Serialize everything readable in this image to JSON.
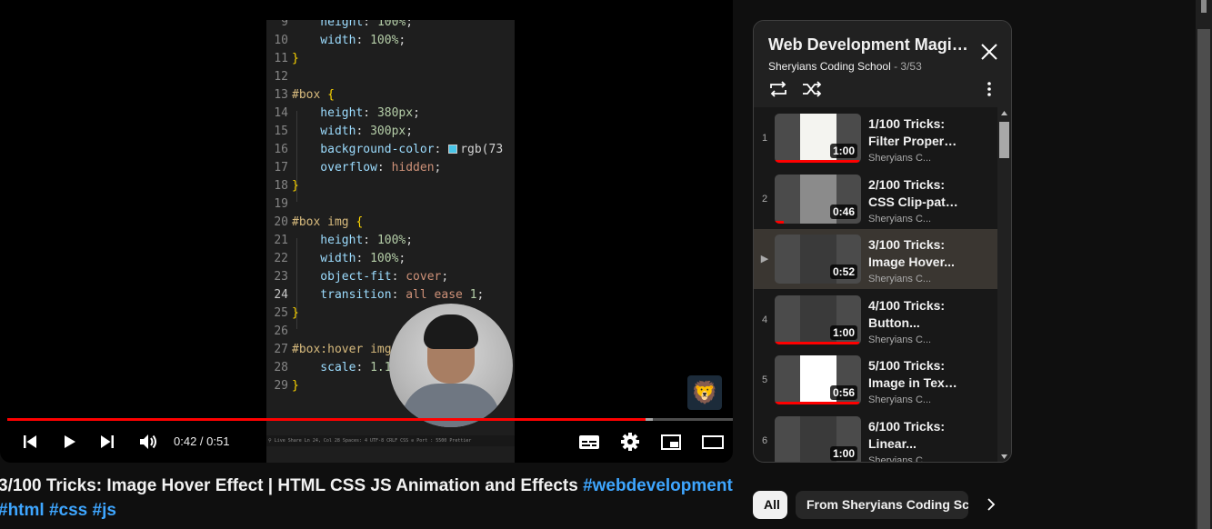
{
  "editor": {
    "lines": [
      {
        "num": "9",
        "text": [
          {
            "c": "tk-prop",
            "t": "    height"
          },
          {
            "c": "tk-plain",
            "t": ": "
          },
          {
            "c": "tk-val",
            "t": "100%"
          },
          {
            "c": "tk-plain",
            "t": ";"
          }
        ]
      },
      {
        "num": "10",
        "text": [
          {
            "c": "tk-prop",
            "t": "    width"
          },
          {
            "c": "tk-plain",
            "t": ": "
          },
          {
            "c": "tk-val",
            "t": "100%"
          },
          {
            "c": "tk-plain",
            "t": ";"
          }
        ]
      },
      {
        "num": "11",
        "text": [
          {
            "c": "tk-brace",
            "t": "}"
          }
        ]
      },
      {
        "num": "12",
        "text": []
      },
      {
        "num": "13",
        "text": [
          {
            "c": "tk-sel",
            "t": "#box "
          },
          {
            "c": "tk-brace",
            "t": "{"
          }
        ]
      },
      {
        "num": "14",
        "text": [
          {
            "c": "tk-prop",
            "t": "    height"
          },
          {
            "c": "tk-plain",
            "t": ": "
          },
          {
            "c": "tk-val",
            "t": "380px"
          },
          {
            "c": "tk-plain",
            "t": ";"
          }
        ]
      },
      {
        "num": "15",
        "text": [
          {
            "c": "tk-prop",
            "t": "    width"
          },
          {
            "c": "tk-plain",
            "t": ": "
          },
          {
            "c": "tk-val",
            "t": "300px"
          },
          {
            "c": "tk-plain",
            "t": ";"
          }
        ]
      },
      {
        "num": "16",
        "text": [
          {
            "c": "tk-prop",
            "t": "    background-color"
          },
          {
            "c": "tk-plain",
            "t": ": "
          },
          {
            "c": "swatch",
            "t": ""
          },
          {
            "c": "tk-plain",
            "t": "rgb(73"
          }
        ]
      },
      {
        "num": "17",
        "text": [
          {
            "c": "tk-prop",
            "t": "    overflow"
          },
          {
            "c": "tk-plain",
            "t": ": "
          },
          {
            "c": "tk-kw",
            "t": "hidden"
          },
          {
            "c": "tk-plain",
            "t": ";"
          }
        ]
      },
      {
        "num": "18",
        "text": [
          {
            "c": "tk-brace",
            "t": "}"
          }
        ]
      },
      {
        "num": "19",
        "text": []
      },
      {
        "num": "20",
        "text": [
          {
            "c": "tk-sel",
            "t": "#box img "
          },
          {
            "c": "tk-brace",
            "t": "{"
          }
        ]
      },
      {
        "num": "21",
        "text": [
          {
            "c": "tk-prop",
            "t": "    height"
          },
          {
            "c": "tk-plain",
            "t": ": "
          },
          {
            "c": "tk-val",
            "t": "100%"
          },
          {
            "c": "tk-plain",
            "t": ";"
          }
        ]
      },
      {
        "num": "22",
        "text": [
          {
            "c": "tk-prop",
            "t": "    width"
          },
          {
            "c": "tk-plain",
            "t": ": "
          },
          {
            "c": "tk-val",
            "t": "100%"
          },
          {
            "c": "tk-plain",
            "t": ";"
          }
        ]
      },
      {
        "num": "23",
        "text": [
          {
            "c": "tk-prop",
            "t": "    object-fit"
          },
          {
            "c": "tk-plain",
            "t": ": "
          },
          {
            "c": "tk-kw",
            "t": "cover"
          },
          {
            "c": "tk-plain",
            "t": ";"
          }
        ]
      },
      {
        "num": "24",
        "text": [
          {
            "c": "tk-prop",
            "t": "    transition"
          },
          {
            "c": "tk-plain",
            "t": ": "
          },
          {
            "c": "tk-kw",
            "t": "all ease "
          },
          {
            "c": "tk-val",
            "t": "1"
          },
          {
            "c": "tk-plain",
            "t": ";"
          }
        ],
        "current": true
      },
      {
        "num": "25",
        "text": [
          {
            "c": "tk-brace",
            "t": "}"
          }
        ]
      },
      {
        "num": "26",
        "text": []
      },
      {
        "num": "27",
        "text": [
          {
            "c": "tk-sel",
            "t": "#box:hover img"
          }
        ]
      },
      {
        "num": "28",
        "text": [
          {
            "c": "tk-prop",
            "t": "    scale"
          },
          {
            "c": "tk-plain",
            "t": ": "
          },
          {
            "c": "tk-val",
            "t": "1.1"
          }
        ]
      },
      {
        "num": "29",
        "text": [
          {
            "c": "tk-brace",
            "t": "}"
          }
        ]
      }
    ],
    "status_bar": "⚲ Live Share        Ln 24, Col 28   Spaces: 4   UTF-8   CRLF   CSS   ⊘ Port : 5500   Prettier"
  },
  "player": {
    "time_current": "0:42",
    "time_separator": " / ",
    "time_total": "0:51",
    "progress_played": 0.88,
    "progress_loaded": 0.89,
    "watermark_icon": "lion-avatar-icon",
    "accent": "#ff0000"
  },
  "video": {
    "title": "3/100 Tricks: Image Hover Effect | HTML CSS JS Animation and Effects ",
    "hashtags": [
      "#webdevelopment",
      "#html",
      "#css",
      "#js"
    ]
  },
  "playlist": {
    "title": "Web Development Magic Tricks",
    "channel": "Sheryians Coding School",
    "position": "3/53",
    "items": [
      {
        "index": "1",
        "line1": "1/100 Tricks:",
        "line2": "Filter Property...",
        "channel": "Sheryians C...",
        "duration": "1:00",
        "watched": 0.98,
        "thumb": "#f4f4f0",
        "active": false
      },
      {
        "index": "2",
        "line1": "2/100 Tricks:",
        "line2": "CSS Clip-path...",
        "channel": "Sheryians C...",
        "duration": "0:46",
        "watched": 0.1,
        "thumb": "#8b8b8b",
        "active": false
      },
      {
        "index": "▶",
        "line1": "3/100 Tricks:",
        "line2": "Image Hover...",
        "channel": "Sheryians C...",
        "duration": "0:52",
        "watched": 0.0,
        "thumb": "#3a3a3a",
        "active": true
      },
      {
        "index": "4",
        "line1": "4/100 Tricks:",
        "line2": "Button...",
        "channel": "Sheryians C...",
        "duration": "1:00",
        "watched": 0.98,
        "thumb": "#3a3a3a",
        "active": false
      },
      {
        "index": "5",
        "line1": "5/100 Tricks:",
        "line2": "Image in Text...",
        "channel": "Sheryians C...",
        "duration": "0:56",
        "watched": 0.98,
        "thumb": "#ffffff",
        "active": false
      },
      {
        "index": "6",
        "line1": "6/100 Tricks:",
        "line2": "Linear...",
        "channel": "Sheryians C...",
        "duration": "1:00",
        "watched": 0.98,
        "thumb": "#3a3a3a",
        "active": false
      }
    ]
  },
  "chips": {
    "all": "All",
    "from": "From Sheryians Coding School"
  }
}
